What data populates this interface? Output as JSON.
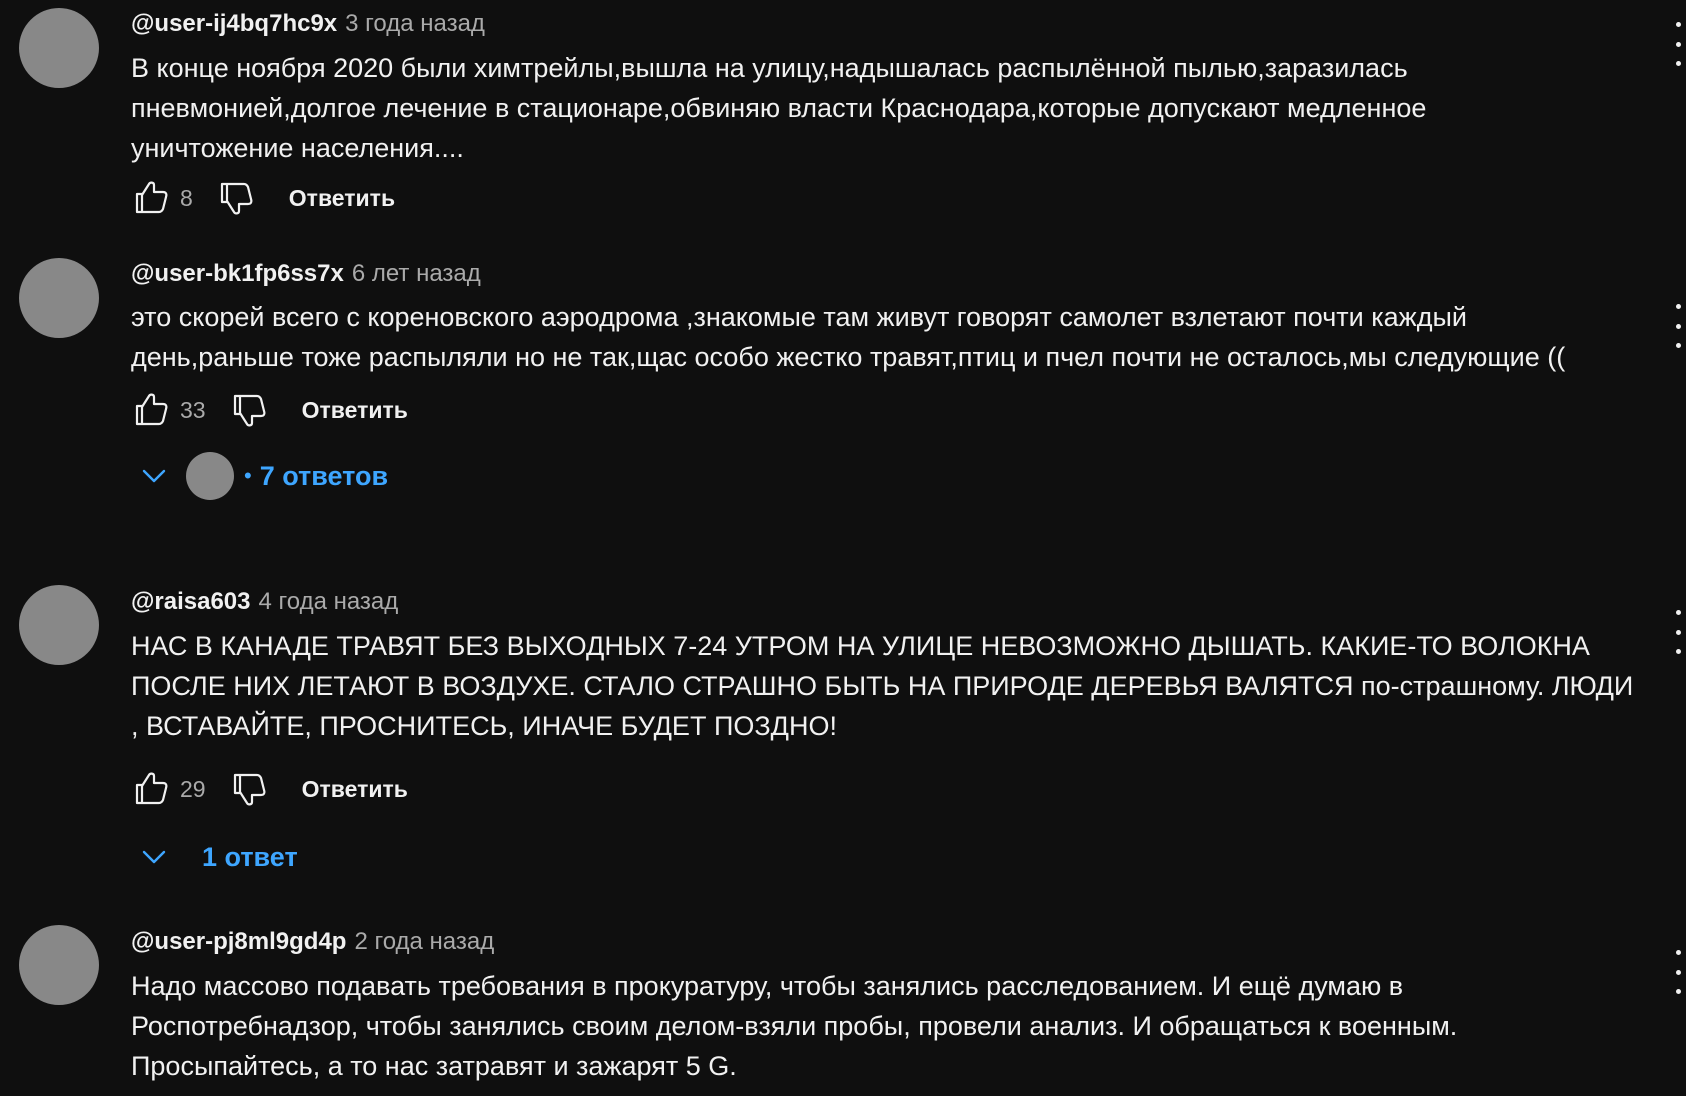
{
  "comments": [
    {
      "author": "@user-ij4bq7hc9x",
      "time": "3 года назад",
      "lines": [
        "В конце ноября 2020 были химтрейлы,вышла на улицу,надышалась распылённой пылью,заразилась",
        "пневмонией,долгое лечение в стационаре,обвиняю власти Краснодара,которые допускают медленное",
        "уничтожение населения...."
      ],
      "likes": "8",
      "reply_label": "Ответить"
    },
    {
      "author": "@user-bk1fp6ss7x",
      "time": "6 лет назад",
      "lines": [
        "это скорей всего с кореновского аэродрома ,знакомые там живут говорят самолет взлетают почти каждый",
        "день,раньше тоже распыляли но не так,щас особо жестко травят,птиц и пчел почти не осталось,мы следующие (("
      ],
      "likes": "33",
      "reply_label": "Ответить",
      "replies_dot": "•",
      "replies_label": "7 ответов"
    },
    {
      "author": "@raisa603",
      "time": "4 года назад",
      "lines": [
        "НАС В КАНАДЕ ТРАВЯТ БЕЗ ВЫХОДНЫХ 7-24 УТРОМ НА УЛИЦЕ НЕВОЗМОЖНО ДЫШАТЬ. КАКИЕ-ТО ВОЛОКНА",
        "ПОСЛЕ НИХ ЛЕТАЮТ В ВОЗДУХЕ. СТАЛО СТРАШНО БЫТЬ НА ПРИРОДЕ ДЕРЕВЬЯ ВАЛЯТСЯ по-страшному. ЛЮДИ",
        ", ВСТАВАЙТЕ, ПРОСНИТЕСЬ, ИНАЧЕ БУДЕТ ПОЗДНО!"
      ],
      "likes": "29",
      "reply_label": "Ответить",
      "replies_label": "1 ответ"
    },
    {
      "author": "@user-pj8ml9gd4p",
      "time": "2 года назад",
      "lines": [
        "Надо массово подавать требования в прокуратуру, чтобы занялись расследованием. И ещё думаю в",
        "Роспотребнадзор, чтобы занялись своим делом-взяли пробы, провели анализ. И обращаться к военным.",
        "Просыпайтесь, а то нас затравят и зажарят 5 G."
      ]
    }
  ],
  "icons": {
    "like": "thumb-up-icon",
    "dislike": "thumb-down-icon",
    "expand": "chevron-down-icon",
    "menu": "more-vert-icon"
  },
  "colors": {
    "background": "#0f0f0f",
    "text": "#f1f1f1",
    "secondary_text": "#aaaaaa",
    "link": "#3ea6ff",
    "avatar": "#888888"
  }
}
